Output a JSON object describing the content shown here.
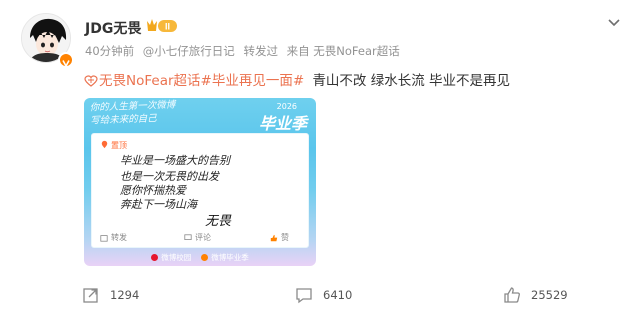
{
  "user": {
    "name": "JDG无畏",
    "level_badge": "II",
    "avatar_icon": "anime-character-avatar",
    "verified_icon": "v-verified-icon"
  },
  "meta": {
    "time": "40分钟前",
    "app": "@小七仔旅行日记",
    "sent": "转发过",
    "from": "来自 无畏NoFear超话"
  },
  "post": {
    "topic": "无畏NoFear超话#毕业再见一面#",
    "text": "青山不改 绿水长流 毕业不是再见"
  },
  "card": {
    "handwritten_top": [
      "你的人生第一次微博",
      "写给未来的自己"
    ],
    "year": "2026",
    "season": "毕业季",
    "pin_label": "置顶",
    "lines": [
      "毕业是一场盛大的告别",
      "也是一次无畏的出发",
      "愿你怀揣热爱",
      "奔赴下一场山海"
    ],
    "signature": "无畏",
    "mini_repost": "转发",
    "mini_comment": "评论",
    "mini_like": "赞",
    "footer_left": "微博校园",
    "footer_right": "微博毕业季"
  },
  "actions": {
    "repost_count": "1294",
    "comment_count": "6410",
    "like_count": "25529"
  },
  "colors": {
    "topic": "#eb7350",
    "meta": "#939393",
    "accent": "#ff8200"
  }
}
